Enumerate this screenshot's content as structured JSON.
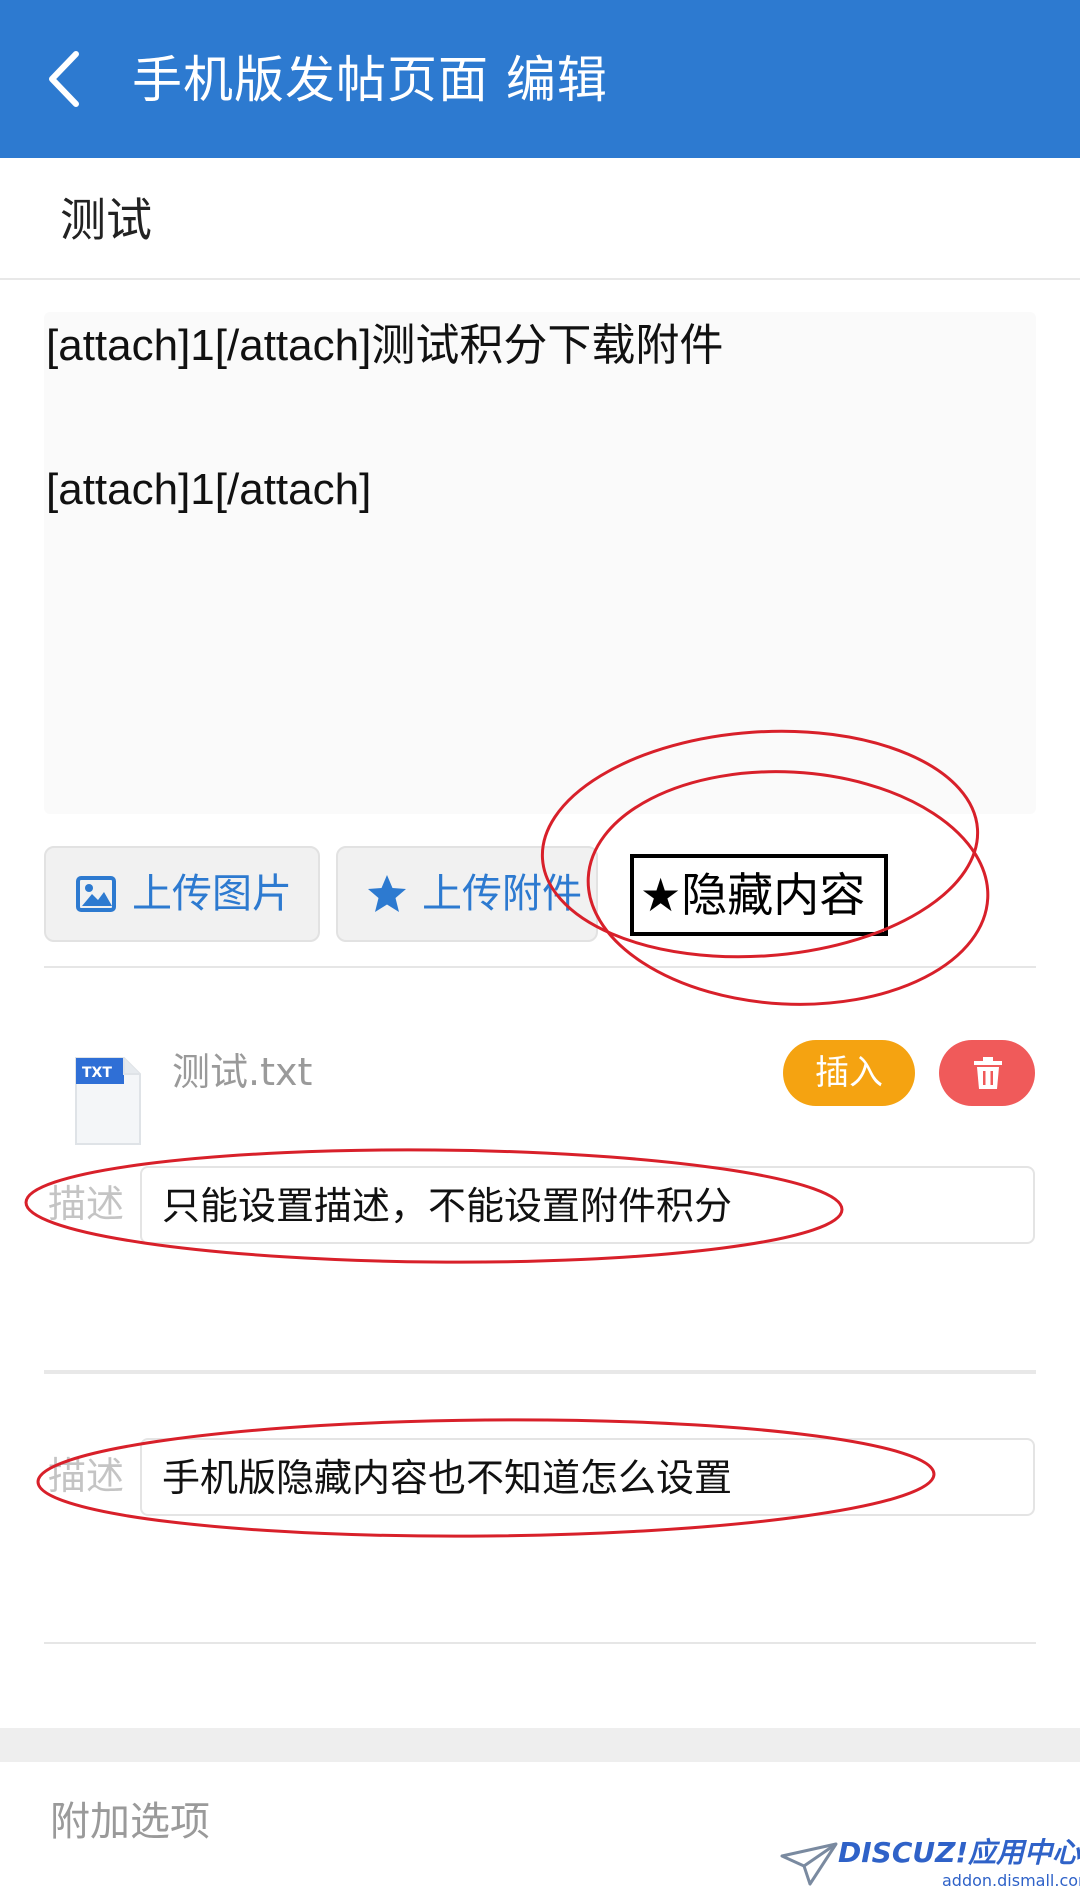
{
  "header": {
    "back_icon": "chevron-left-icon",
    "title": "手机版发帖页面 编辑"
  },
  "subject": {
    "value": "测试"
  },
  "editor": {
    "lines": [
      "[attach]1[/attach]测试积分下载附件",
      "[attach]1[/attach]"
    ]
  },
  "toolbar": {
    "upload_image_icon": "image-icon",
    "upload_image_label": "上传图片",
    "upload_attachment_icon": "star-icon",
    "upload_attachment_label": "上传附件",
    "hidden_content_label": "★隐藏内容"
  },
  "attachment": {
    "file_icon": "txt-file-icon",
    "file_name": "测试.txt",
    "insert_label": "插入",
    "delete_icon": "trash-icon",
    "desc_label": "描述",
    "desc_value": "只能设置描述，不能设置附件积分"
  },
  "attachment2": {
    "desc_label": "描述",
    "desc_value": "手机版隐藏内容也不知道怎么设置"
  },
  "extra_options": {
    "label": "附加选项"
  },
  "watermark": {
    "brand": "DISCUZ!应用中心",
    "site": "addon.dismall.com"
  },
  "colors": {
    "header_bg": "#2d7ad0",
    "accent_blue": "#2d7ad0",
    "insert_orange": "#f5a311",
    "delete_red": "#f05a5a",
    "annotation_red": "#d8202a"
  }
}
